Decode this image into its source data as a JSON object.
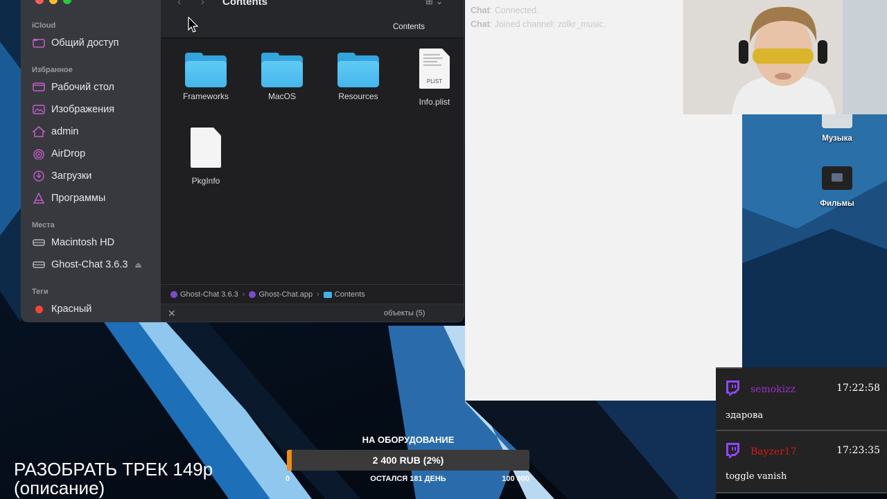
{
  "finder": {
    "window_title": "Contents",
    "tab_label": "Contents",
    "sidebar": {
      "sections": [
        {
          "title": "iCloud",
          "items": [
            {
              "label": "Общий доступ",
              "icon": "shared-folder-icon"
            }
          ]
        },
        {
          "title": "Избранное",
          "items": [
            {
              "label": "Рабочий стол",
              "icon": "desktop-icon"
            },
            {
              "label": "Изображения",
              "icon": "pictures-icon"
            },
            {
              "label": "admin",
              "icon": "home-icon"
            },
            {
              "label": "AirDrop",
              "icon": "airdrop-icon"
            },
            {
              "label": "Загрузки",
              "icon": "downloads-icon"
            },
            {
              "label": "Программы",
              "icon": "applications-icon"
            }
          ]
        },
        {
          "title": "Места",
          "items": [
            {
              "label": "Macintosh HD",
              "icon": "disk-icon"
            },
            {
              "label": "Ghost-Chat 3.6.3",
              "icon": "disk-icon"
            }
          ]
        },
        {
          "title": "Теги",
          "items": [
            {
              "label": "Красный",
              "icon": "red-tag-icon",
              "color": "#ff453a"
            }
          ]
        }
      ]
    },
    "files": [
      {
        "name": "Frameworks",
        "type": "folder"
      },
      {
        "name": "MacOS",
        "type": "folder"
      },
      {
        "name": "Resources",
        "type": "folder"
      },
      {
        "name": "Info.plist",
        "type": "plist",
        "tag": "PLIST"
      },
      {
        "name": "PkgInfo",
        "type": "document"
      }
    ],
    "path": [
      "Ghost-Chat 3.6.3",
      "Ghost-Chat.app",
      "Contents"
    ],
    "status": "объекты (5)"
  },
  "chat_panel": {
    "lines": [
      {
        "prefix": "Chat",
        "text": ": Connected."
      },
      {
        "prefix": "Chat",
        "text": ": Joined channel: zolkr_music."
      }
    ]
  },
  "desktop_icons": [
    {
      "label": "Музыка",
      "icon": "music-folder-icon"
    },
    {
      "label": "Фильмы",
      "icon": "movies-folder-icon"
    }
  ],
  "twitch_chat": [
    {
      "user": "semokizz",
      "user_color": "#9b2ec7",
      "time": "17:22:58",
      "text": "здарова"
    },
    {
      "user": "Bayzer17",
      "user_color": "#d11a1a",
      "time": "17:23:35",
      "text": "toggle vanish"
    }
  ],
  "goal": {
    "title": "НА ОБОРУДОВАНИЕ",
    "amount": "2 400 RUB (2%)",
    "percent": 2,
    "min": "0",
    "remaining": "ОСТАЛСЯ 181 ДЕНЬ",
    "max": "100 000",
    "fill_color": "#f08a1a"
  },
  "promo": {
    "line1": "РАЗОБРАТЬ ТРЕК 149р",
    "line2": "(описание)"
  }
}
